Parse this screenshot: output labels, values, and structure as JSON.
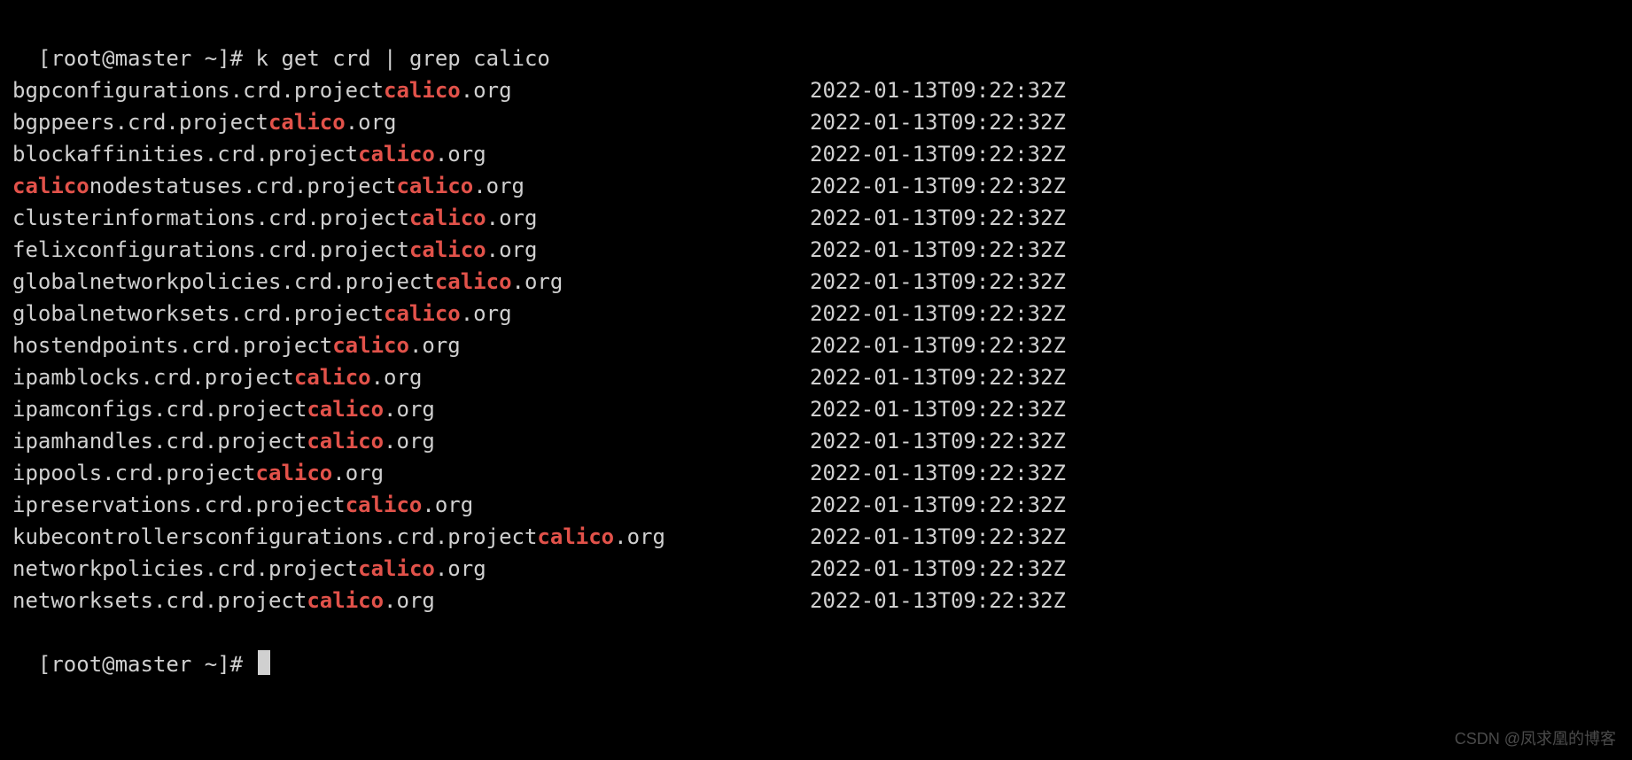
{
  "prompt": "[root@master ~]# ",
  "command": "k get crd | grep calico",
  "highlight": "calico",
  "rows": [
    {
      "name": "bgpconfigurations.crd.projectcalico.org",
      "ts": "2022-01-13T09:22:32Z"
    },
    {
      "name": "bgppeers.crd.projectcalico.org",
      "ts": "2022-01-13T09:22:32Z"
    },
    {
      "name": "blockaffinities.crd.projectcalico.org",
      "ts": "2022-01-13T09:22:32Z"
    },
    {
      "name": "caliconodestatuses.crd.projectcalico.org",
      "ts": "2022-01-13T09:22:32Z"
    },
    {
      "name": "clusterinformations.crd.projectcalico.org",
      "ts": "2022-01-13T09:22:32Z"
    },
    {
      "name": "felixconfigurations.crd.projectcalico.org",
      "ts": "2022-01-13T09:22:32Z"
    },
    {
      "name": "globalnetworkpolicies.crd.projectcalico.org",
      "ts": "2022-01-13T09:22:32Z"
    },
    {
      "name": "globalnetworksets.crd.projectcalico.org",
      "ts": "2022-01-13T09:22:32Z"
    },
    {
      "name": "hostendpoints.crd.projectcalico.org",
      "ts": "2022-01-13T09:22:32Z"
    },
    {
      "name": "ipamblocks.crd.projectcalico.org",
      "ts": "2022-01-13T09:22:32Z"
    },
    {
      "name": "ipamconfigs.crd.projectcalico.org",
      "ts": "2022-01-13T09:22:32Z"
    },
    {
      "name": "ipamhandles.crd.projectcalico.org",
      "ts": "2022-01-13T09:22:32Z"
    },
    {
      "name": "ippools.crd.projectcalico.org",
      "ts": "2022-01-13T09:22:32Z"
    },
    {
      "name": "ipreservations.crd.projectcalico.org",
      "ts": "2022-01-13T09:22:32Z"
    },
    {
      "name": "kubecontrollersconfigurations.crd.projectcalico.org",
      "ts": "2022-01-13T09:22:32Z"
    },
    {
      "name": "networkpolicies.crd.projectcalico.org",
      "ts": "2022-01-13T09:22:32Z"
    },
    {
      "name": "networksets.crd.projectcalico.org",
      "ts": "2022-01-13T09:22:32Z"
    }
  ],
  "watermark": "CSDN @凤求凰的博客"
}
